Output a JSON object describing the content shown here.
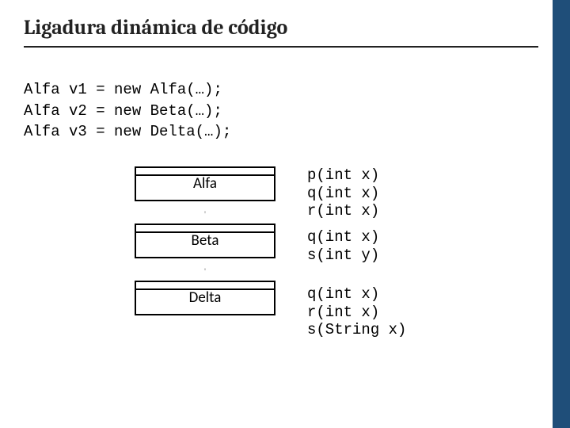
{
  "title": "Ligadura dinámica de código",
  "code": "Alfa v1 = new Alfa(…);\nAlfa v2 = new Beta(…);\nAlfa v3 = new Delta(…);",
  "classes": {
    "alfa": "Alfa",
    "beta": "Beta",
    "delta": "Delta"
  },
  "methods": {
    "alfa": "p(int x)\nq(int x)\nr(int x)",
    "beta": "q(int x)\ns(int y)",
    "delta": "q(int x)\nr(int x)\ns(String x)"
  }
}
